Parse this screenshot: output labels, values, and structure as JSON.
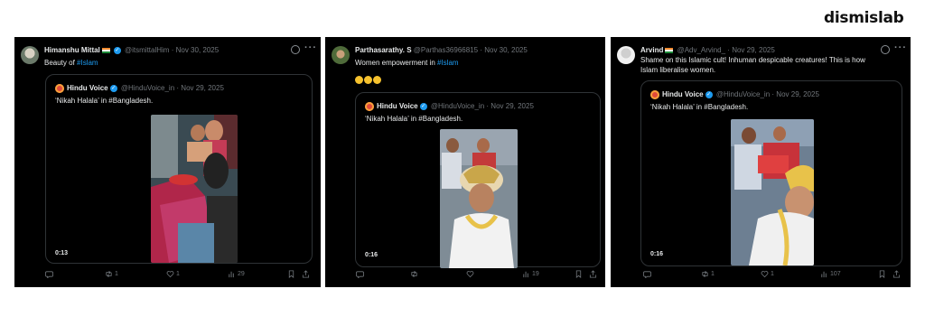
{
  "brand": {
    "logo_text": "dismislab"
  },
  "tweets": [
    {
      "name": "Himanshu Mittal",
      "handle": "@itsmittalHim",
      "sep": "·",
      "date": "Nov 30, 2025",
      "text": "Beauty of ",
      "hashtag": "#Islam",
      "quote": {
        "name": "Hindu Voice",
        "handle": "@HinduVoice_in",
        "sep": "·",
        "date": "Nov 29, 2025",
        "text": "‘Nikah Halala’ in #Bangladesh.",
        "duration": "0:13"
      },
      "actions": {
        "retweets": "1",
        "likes": "1",
        "views": "29"
      }
    },
    {
      "name": "Parthasarathy. S",
      "handle": "@Parthas36966815",
      "sep": "·",
      "date": "Nov 30, 2025",
      "text": "Women empowerment in ",
      "hashtag": "#Islam",
      "quote": {
        "name": "Hindu Voice",
        "handle": "@HinduVoice_in",
        "sep": "·",
        "date": "Nov 29, 2025",
        "text": "‘Nikah Halala’ in #Bangladesh.",
        "duration": "0:16"
      },
      "actions": {
        "retweets": "",
        "likes": "",
        "views": "19"
      }
    },
    {
      "name": "Arvind",
      "handle": "@Adv_Arvind_",
      "sep": "·",
      "date": "Nov 29, 2025",
      "text_line1": "Shame on this Islamic cult! Inhuman despicable creatures! This is how",
      "text_line2": "Islam liberalise women.",
      "quote": {
        "name": "Hindu Voice",
        "handle": "@HinduVoice_in",
        "sep": "·",
        "date": "Nov 29, 2025",
        "text": "‘Nikah Halala’ in #Bangladesh.",
        "duration": "0:16"
      },
      "actions": {
        "retweets": "1",
        "likes": "1",
        "views": "107"
      }
    }
  ],
  "colors": {
    "card_bg": "#000000",
    "link": "#1d9bf0",
    "muted": "#71767b",
    "text": "#e7e9ea"
  }
}
